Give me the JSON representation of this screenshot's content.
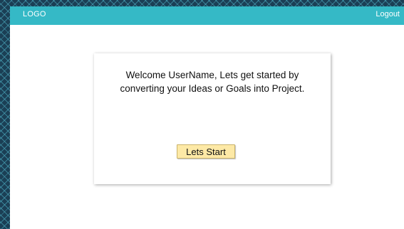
{
  "header": {
    "logo_text": "LOGO",
    "logout_label": "Logout"
  },
  "welcome": {
    "message": "Welcome UserName, Lets get started by converting your Ideas or Goals into Project.",
    "start_button_label": "Lets Start"
  },
  "colors": {
    "header_bar": "#35b9c6",
    "button_fill": "#fde9a6",
    "page_background": "#ffffff",
    "outer_pattern": "#1b3f55"
  }
}
